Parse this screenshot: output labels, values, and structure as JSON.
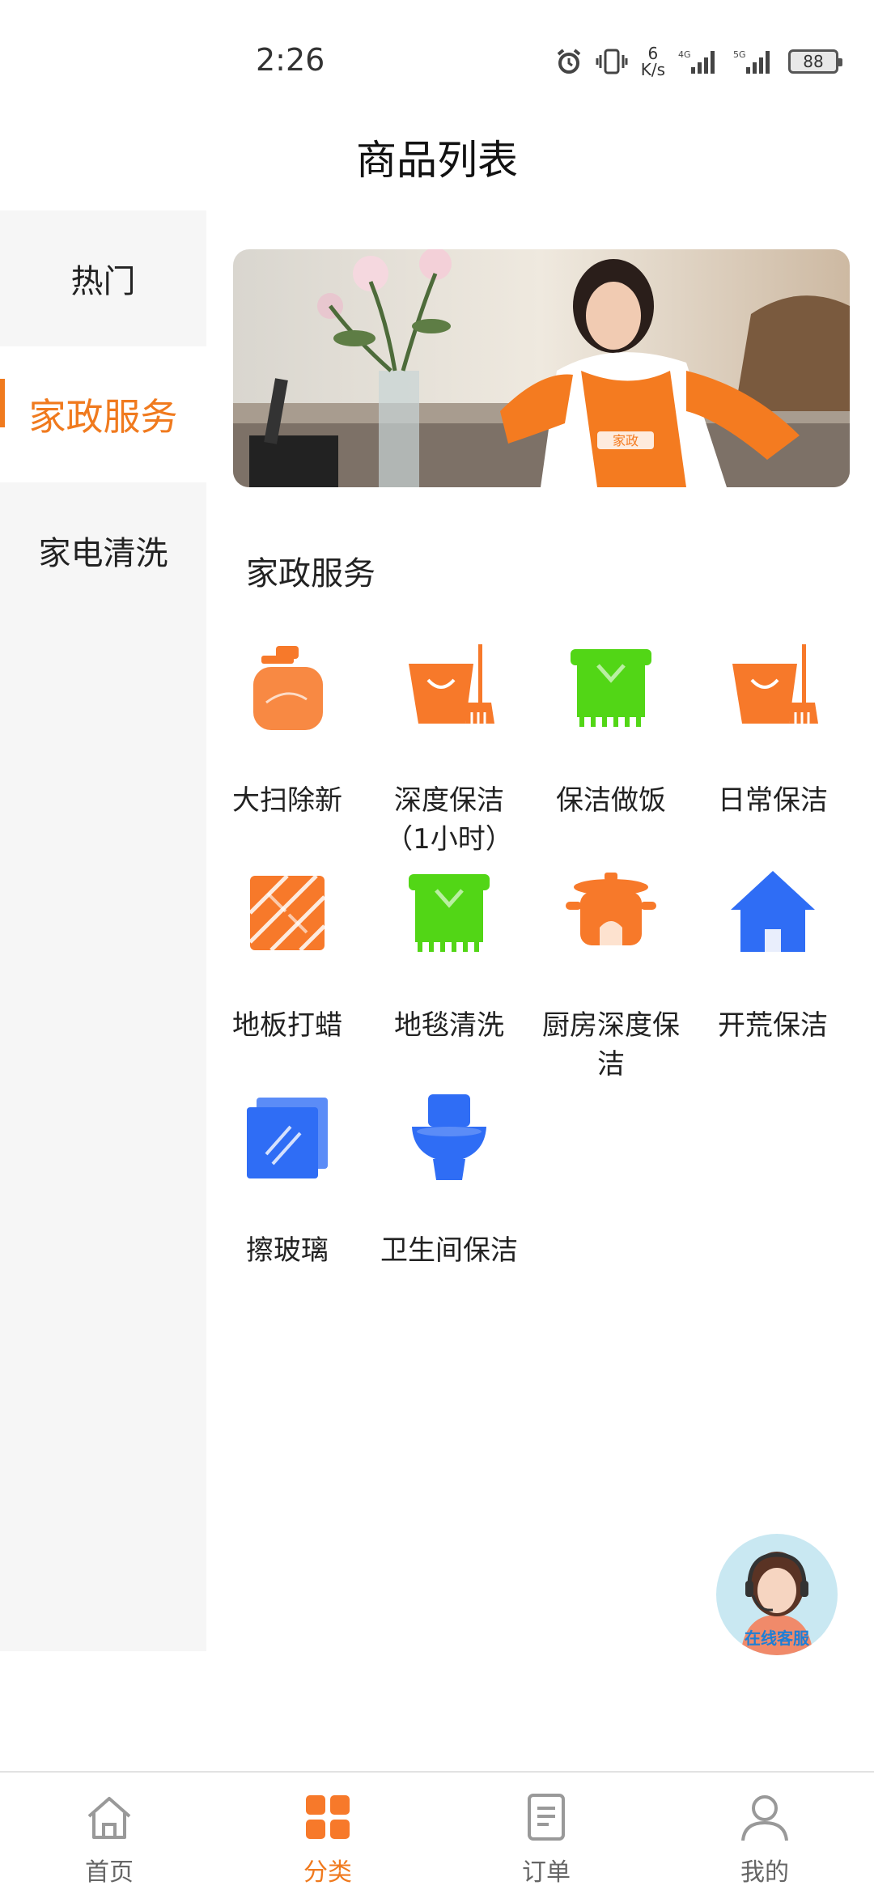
{
  "status_bar": {
    "time": "2:26",
    "speed_value": "6",
    "speed_unit": "K/s",
    "net1": "4G",
    "net2": "5G",
    "battery": "88"
  },
  "header": {
    "title": "商品列表"
  },
  "sidebar": {
    "items": [
      {
        "label": "热门"
      },
      {
        "label": "家政服务"
      },
      {
        "label": "家电清洗"
      }
    ]
  },
  "banner": {
    "badge_text": "家政"
  },
  "section": {
    "title": "家政服务"
  },
  "services": [
    {
      "label": "大扫除新",
      "icon": "spray-bottle-icon",
      "color": "#f7792a"
    },
    {
      "label": "深度保洁（1小时）",
      "icon": "bucket-broom-icon",
      "color": "#f7792a"
    },
    {
      "label": "保洁做饭",
      "icon": "basket-icon",
      "color": "#52d616"
    },
    {
      "label": "日常保洁",
      "icon": "bucket-broom-icon",
      "color": "#f7792a"
    },
    {
      "label": "地板打蜡",
      "icon": "floor-tiles-icon",
      "color": "#f7792a"
    },
    {
      "label": "地毯清洗",
      "icon": "basket-icon",
      "color": "#52d616"
    },
    {
      "label": "厨房深度保洁",
      "icon": "cooking-pot-icon",
      "color": "#f7792a"
    },
    {
      "label": "开荒保洁",
      "icon": "house-icon",
      "color": "#2f6df5"
    },
    {
      "label": "擦玻璃",
      "icon": "glass-pane-icon",
      "color": "#2f6df5"
    },
    {
      "label": "卫生间保洁",
      "icon": "toilet-icon",
      "color": "#2f6df5"
    }
  ],
  "customer_service": {
    "label": "在线客服"
  },
  "tabbar": {
    "items": [
      {
        "label": "首页",
        "icon": "home-icon"
      },
      {
        "label": "分类",
        "icon": "category-grid-icon"
      },
      {
        "label": "订单",
        "icon": "order-document-icon"
      },
      {
        "label": "我的",
        "icon": "profile-icon"
      }
    ],
    "active_color": "#f07a1e"
  }
}
